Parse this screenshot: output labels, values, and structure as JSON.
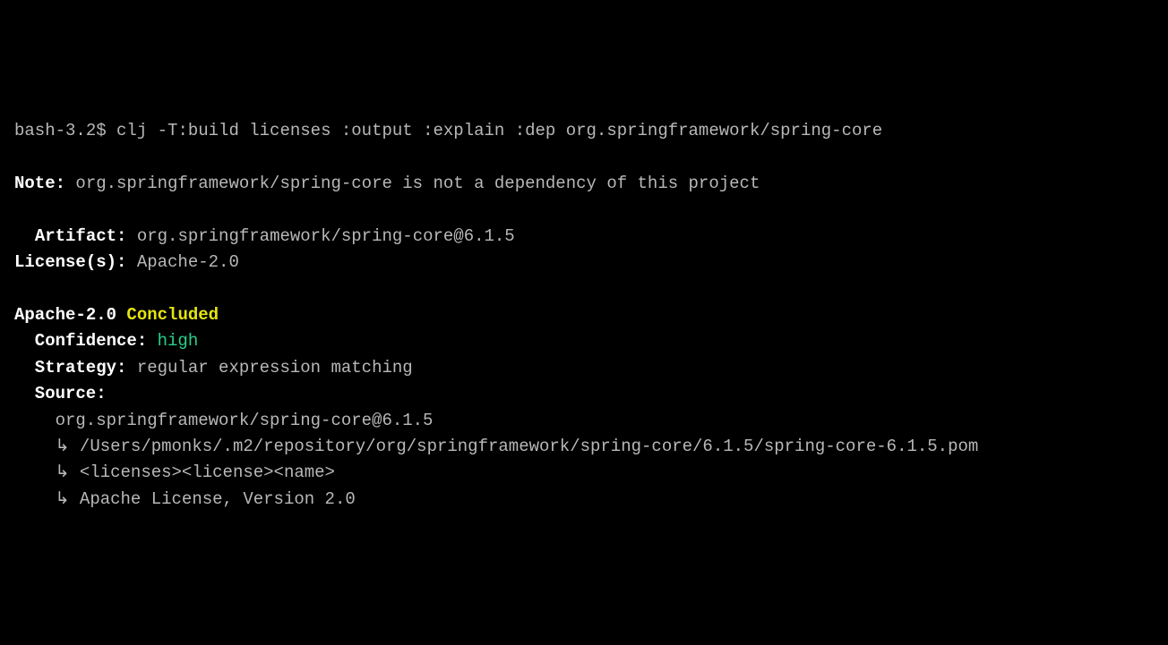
{
  "prompt": "bash-3.2$ ",
  "command": "clj -T:build licenses :output :explain :dep org.springframework/spring-core",
  "note": {
    "label": "Note:",
    "text": " org.springframework/spring-core is not a dependency of this project"
  },
  "artifact": {
    "label": "  Artifact:",
    "value": " org.springframework/spring-core@6.1.5"
  },
  "licenses": {
    "label": "License(s):",
    "value": " Apache-2.0"
  },
  "conclusion": {
    "license": "Apache-2.0",
    "status": " Concluded"
  },
  "confidence": {
    "label": "Confidence:",
    "value": " high"
  },
  "strategy": {
    "label": "Strategy:",
    "value": " regular expression matching"
  },
  "source": {
    "label": "Source:",
    "line1": "org.springframework/spring-core@6.1.5",
    "line2": "↳ /Users/pmonks/.m2/repository/org/springframework/spring-core/6.1.5/spring-core-6.1.5.pom",
    "line3": "↳ <licenses><license><name>",
    "line4": "↳ Apache License, Version 2.0"
  }
}
